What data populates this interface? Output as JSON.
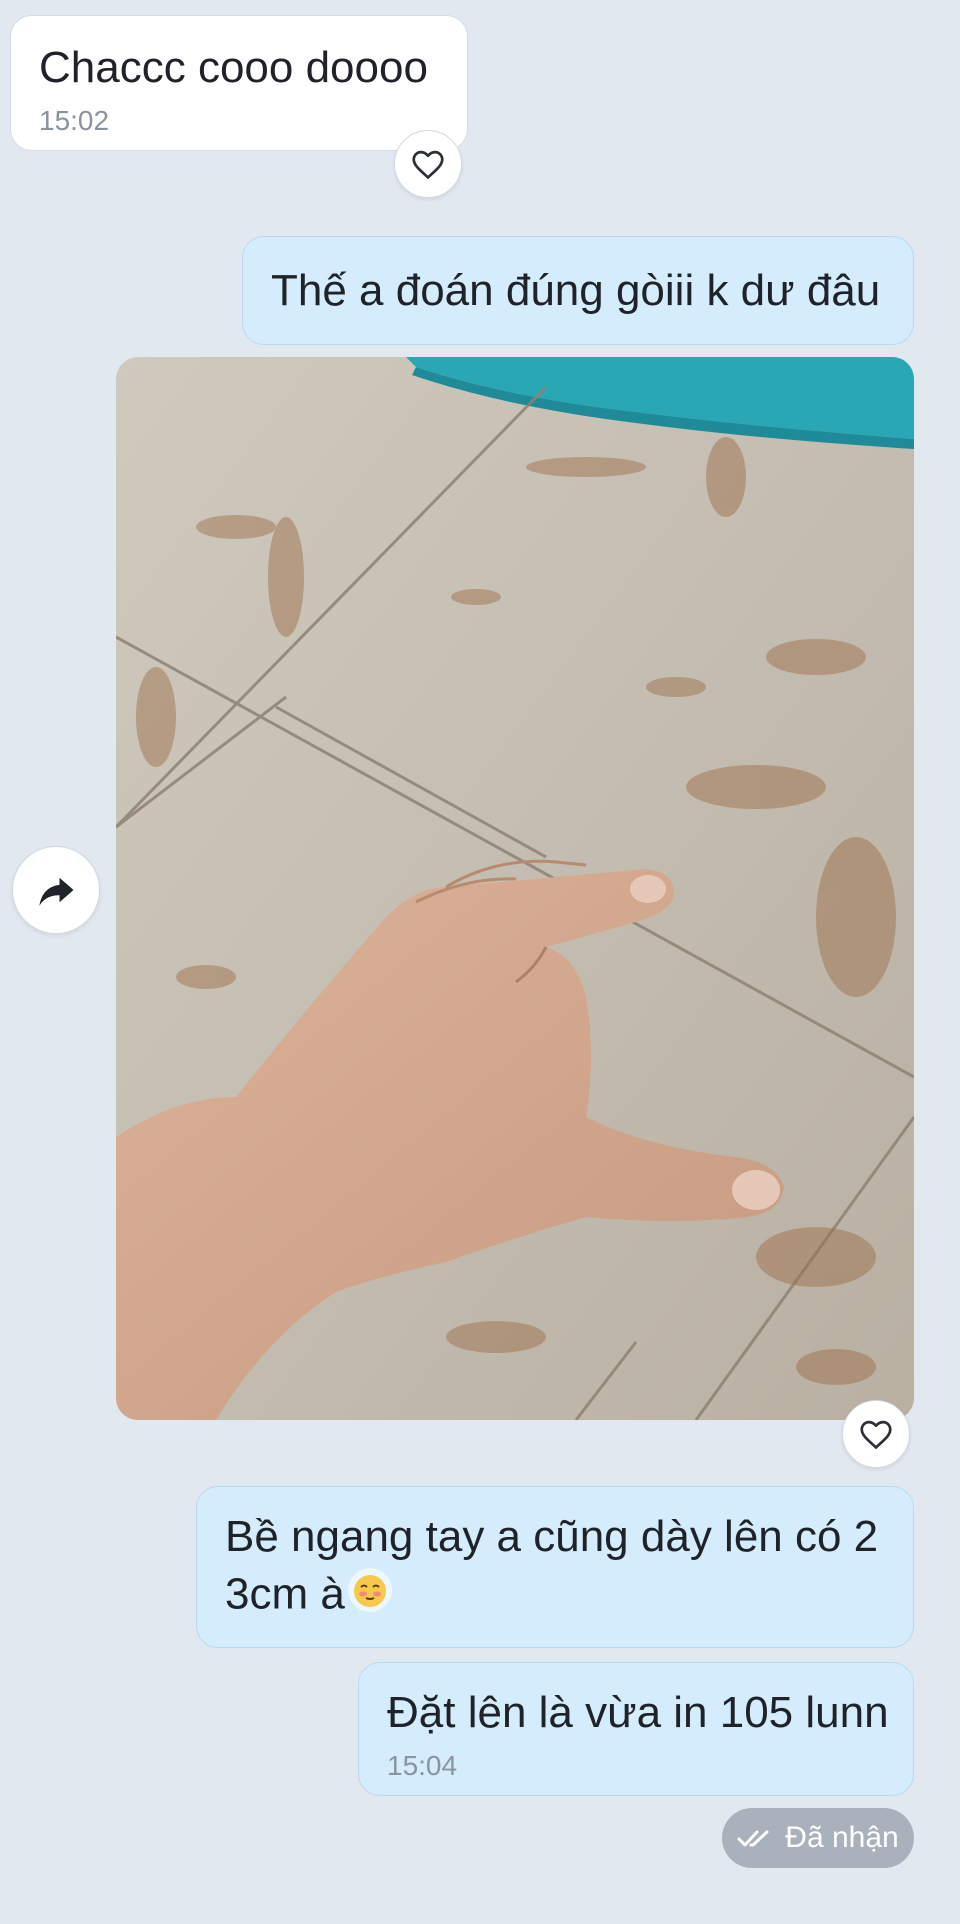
{
  "messages": [
    {
      "id": "m1",
      "direction": "incoming",
      "text": "Chaccc cooo doooo",
      "time": "15:02"
    },
    {
      "id": "m2",
      "direction": "outgoing",
      "text": "Thế a đoán đúng gòiii k dư đâu"
    },
    {
      "id": "m3",
      "direction": "outgoing",
      "type": "photo",
      "description_icon": "photo-hand-on-tile-floor"
    },
    {
      "id": "m4",
      "direction": "outgoing",
      "text_line1": "Bề ngang tay a cũng dày lên có 2",
      "text_line2": "3cm à",
      "emoji": "blushing-face-emoji"
    },
    {
      "id": "m5",
      "direction": "outgoing",
      "text": "Đặt lên là vừa in 105 lunn",
      "time": "15:04"
    }
  ],
  "status": {
    "label": "Đã nhận",
    "icon": "double-check-icon"
  },
  "icons": {
    "reaction": "heart-outline-icon",
    "share": "share-arrow-icon"
  },
  "colors": {
    "background": "#e2e8f0",
    "incoming_bubble": "#ffffff",
    "outgoing_bubble": "#d5ecfd",
    "time_text": "#8a949e",
    "status_pill": "#a9b2bc"
  }
}
